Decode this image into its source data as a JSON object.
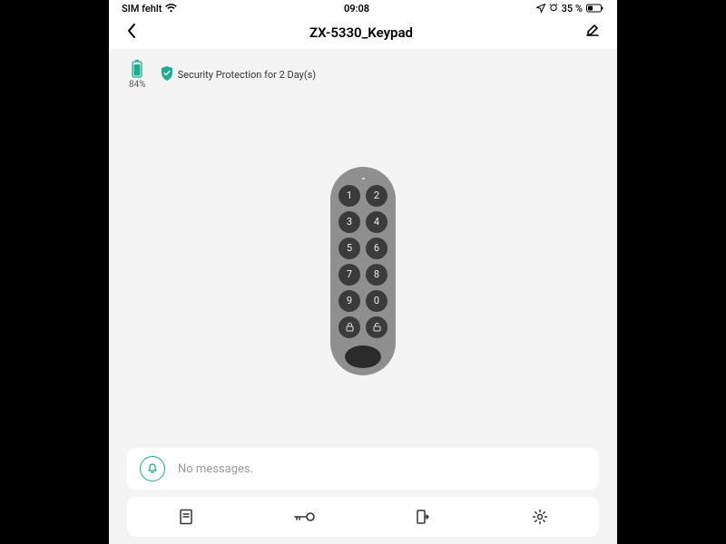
{
  "statusbar": {
    "carrier": "SIM fehlt",
    "time": "09:08",
    "battery_text": "35 %"
  },
  "header": {
    "title": "ZX-5330_Keypad"
  },
  "device": {
    "battery_pct": "84%",
    "security_text": "Security Protection for 2 Day(s)"
  },
  "keypad": {
    "keys": [
      "1",
      "2",
      "3",
      "4",
      "5",
      "6",
      "7",
      "8",
      "9",
      "0"
    ]
  },
  "messages": {
    "text": "No messages."
  }
}
